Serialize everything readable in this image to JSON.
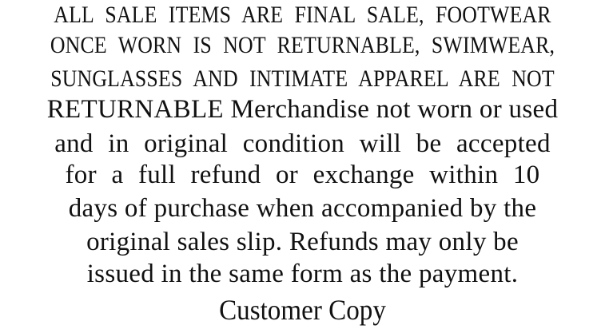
{
  "policy": {
    "lines": [
      "ALL  SALE  ITEMS  ARE FINAL   SALE,   FOOTWEAR",
      "ONCE WORN IS  NOT  RETURNABLE,  SWIMWEAR,",
      "SUNGLASSES  AND INTIMATE  APPAREL  ARE   NOT",
      "RETURNABLE Merchandise not worn or used",
      "and  in  original   condition   will  be accepted",
      "for   a full   refund   or  exchange within 10",
      "days of purchase when accompanied by the",
      "original sales slip. Refunds may only be",
      "issued in the same form as the payment."
    ],
    "footer": "Customer Copy"
  }
}
